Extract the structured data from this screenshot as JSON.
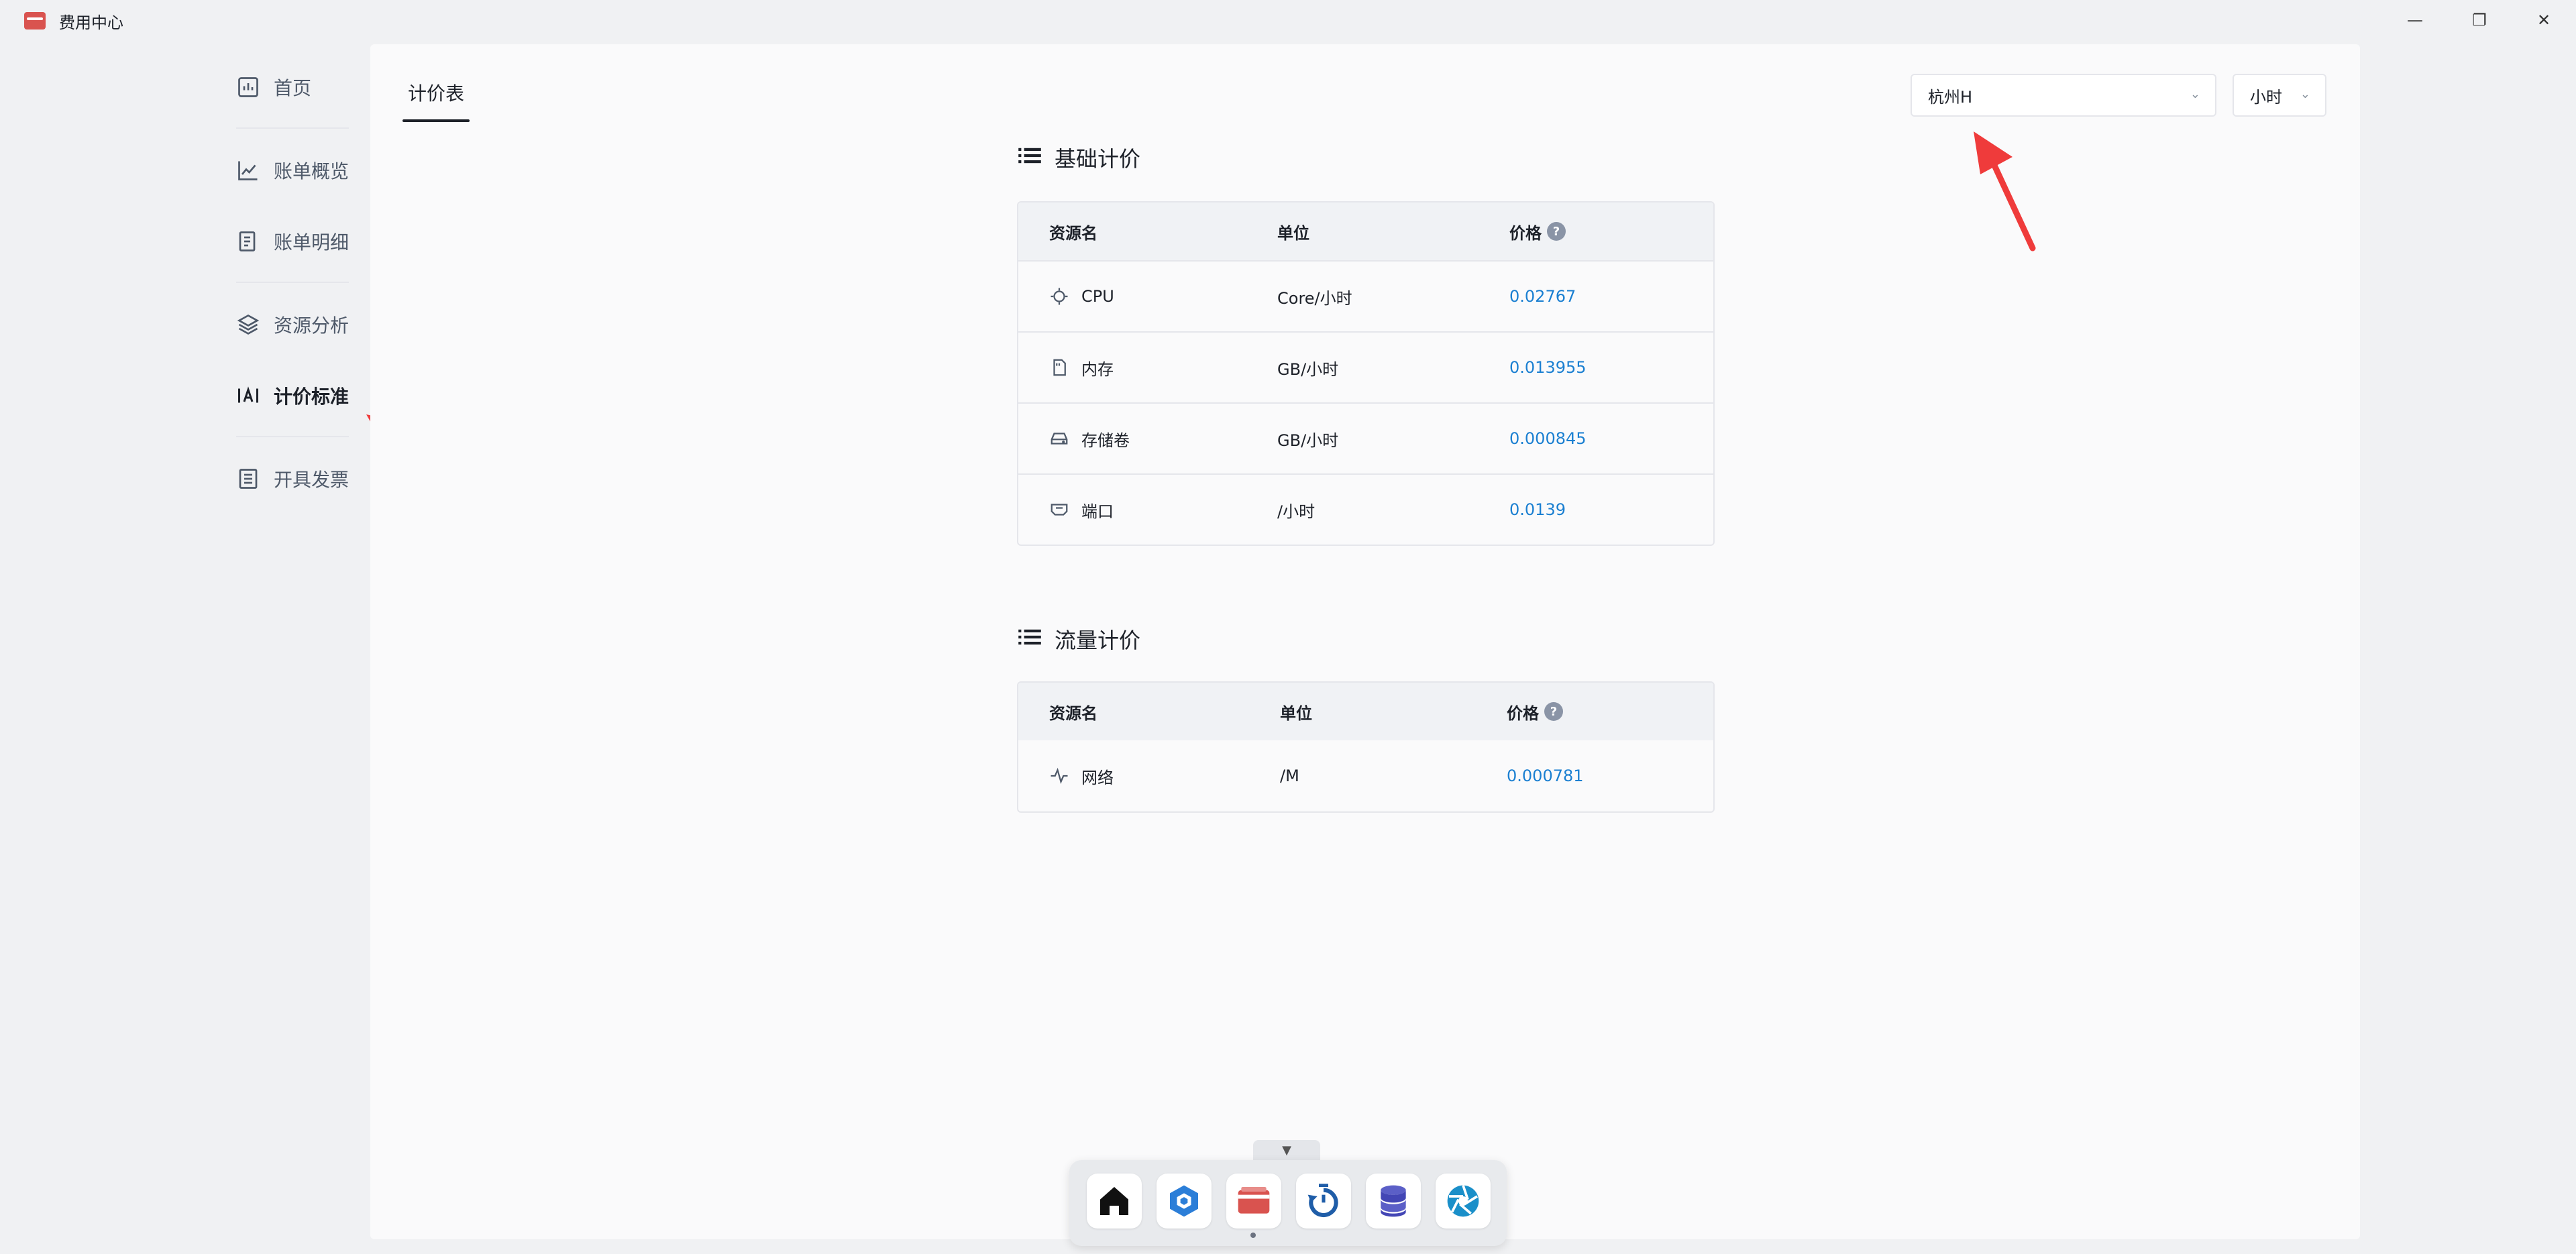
{
  "window": {
    "title": "费用中心",
    "controls": {
      "minimize": "—",
      "restore": "❐",
      "close": "✕"
    }
  },
  "sidebar": {
    "items": [
      {
        "label": "首页",
        "icon": "dashboard-icon"
      },
      {
        "label": "账单概览",
        "icon": "line-chart-icon"
      },
      {
        "label": "账单明细",
        "icon": "receipt-icon"
      },
      {
        "label": "资源分析",
        "icon": "layers-icon"
      },
      {
        "label": "计价标准",
        "icon": "text-cursor-icon",
        "active": true
      },
      {
        "label": "开具发票",
        "icon": "document-icon"
      }
    ]
  },
  "main": {
    "tab": "计价表",
    "region_select": {
      "value": "杭州H"
    },
    "unit_select": {
      "value": "小时"
    },
    "basic_pricing": {
      "title": "基础计价",
      "headers": {
        "name": "资源名",
        "unit": "单位",
        "price": "价格"
      },
      "rows": [
        {
          "name": "CPU",
          "unit": "Core/小时",
          "price": "0.02767",
          "icon": "chip-icon"
        },
        {
          "name": "内存",
          "unit": "GB/小时",
          "price": "0.013955",
          "icon": "memory-card-icon"
        },
        {
          "name": "存储卷",
          "unit": "GB/小时",
          "price": "0.000845",
          "icon": "hard-drive-icon"
        },
        {
          "name": "端口",
          "unit": "/小时",
          "price": "0.0139",
          "icon": "port-icon"
        }
      ]
    },
    "traffic_pricing": {
      "title": "流量计价",
      "headers": {
        "name": "资源名",
        "unit": "单位",
        "price": "价格"
      },
      "rows": [
        {
          "name": "网络",
          "unit": "/M",
          "price": "0.000781",
          "icon": "activity-icon"
        }
      ]
    }
  },
  "dock": {
    "apps": [
      "home-icon",
      "cube-icon",
      "wallet-icon",
      "timer-icon",
      "database-icon",
      "aperture-icon"
    ]
  },
  "colors": {
    "accent_price": "#1a7fd1",
    "annotation_arrow": "#ef3b3b",
    "brand_red": "#d9534f"
  }
}
